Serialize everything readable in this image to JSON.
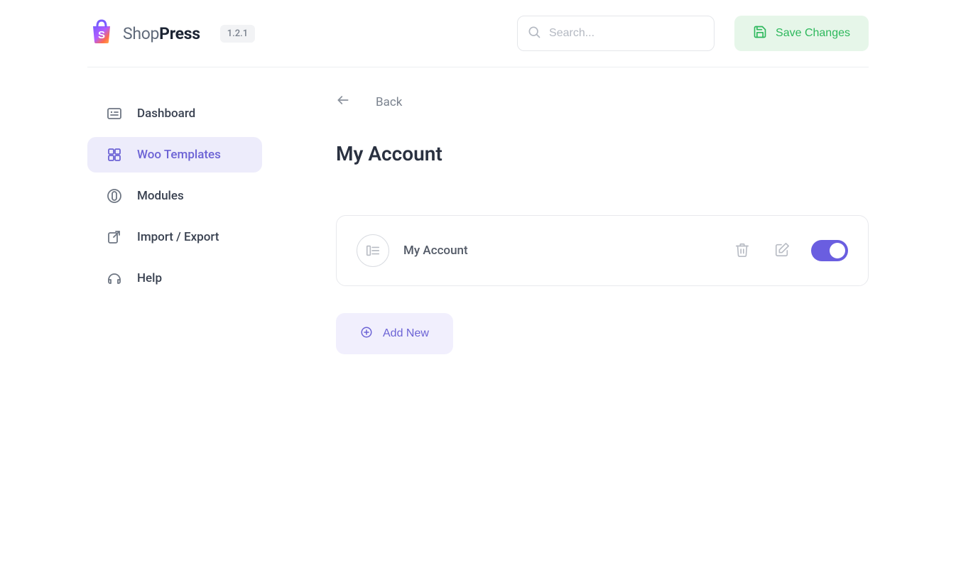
{
  "header": {
    "brand_primary": "Shop",
    "brand_secondary": "Press",
    "version": "1.2.1",
    "search_placeholder": "Search...",
    "save_label": "Save Changes"
  },
  "sidebar": {
    "items": [
      {
        "label": "Dashboard"
      },
      {
        "label": "Woo Templates"
      },
      {
        "label": "Modules"
      },
      {
        "label": "Import / Export"
      },
      {
        "label": "Help"
      }
    ]
  },
  "main": {
    "back_label": "Back",
    "title": "My Account",
    "card_title": "My Account",
    "add_label": "Add New"
  }
}
